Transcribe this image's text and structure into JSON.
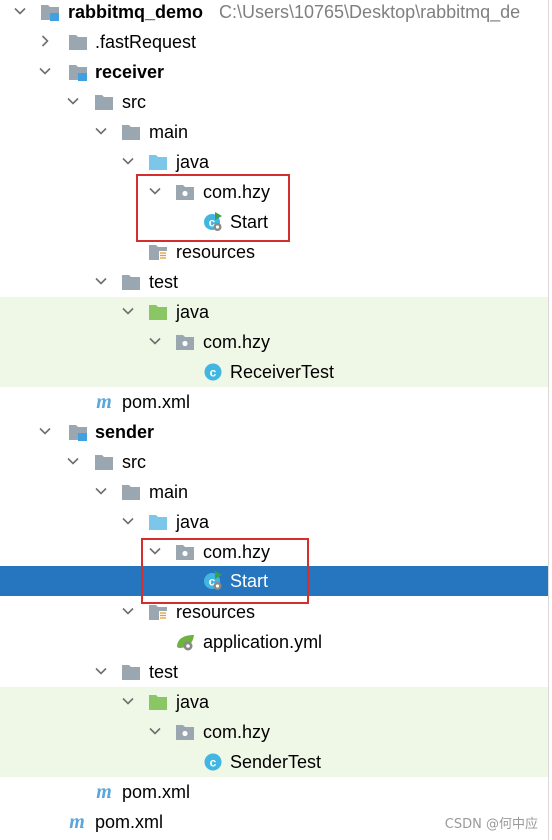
{
  "tree": {
    "root": {
      "name": "rabbitmq_demo",
      "path": "C:\\Users\\10765\\Desktop\\rabbitmq_de"
    },
    "fast_request": ".fastRequest",
    "receiver": {
      "name": "receiver",
      "src": "src",
      "main": "main",
      "java": "java",
      "package": "com.hzy",
      "start": "Start",
      "resources": "resources",
      "test": "test",
      "test_java": "java",
      "test_package": "com.hzy",
      "test_class": "ReceiverTest",
      "pom": "pom.xml"
    },
    "sender": {
      "name": "sender",
      "src": "src",
      "main": "main",
      "java": "java",
      "package": "com.hzy",
      "start": "Start",
      "resources": "resources",
      "application_yml": "application.yml",
      "test": "test",
      "test_java": "java",
      "test_package": "com.hzy",
      "test_class": "SenderTest",
      "pom": "pom.xml"
    },
    "root_pom": "pom.xml",
    "selected_item": "sender/src/main/java/com.hzy/Start"
  },
  "watermark": "CSDN @何中应",
  "colors": {
    "selection": "#2675bf",
    "test_background": "#eff7e6",
    "highlight_box": "#d32f2f",
    "source_folder": "#7cc6ea",
    "test_folder": "#8bc665",
    "plain_folder": "#9aa7b0",
    "maven": "#5aa6dd",
    "class_icon": "#40b6e0"
  },
  "icons": {
    "expand": "chevron-down-icon",
    "collapse": "chevron-right-icon",
    "module": "module-folder-icon",
    "folder": "folder-icon",
    "source_root": "source-root-folder-icon",
    "test_root": "test-root-folder-icon",
    "package": "package-icon",
    "resources": "resources-folder-icon",
    "class_runnable": "runnable-class-icon",
    "class": "class-icon",
    "maven": "maven-icon",
    "yaml": "spring-yaml-icon"
  }
}
